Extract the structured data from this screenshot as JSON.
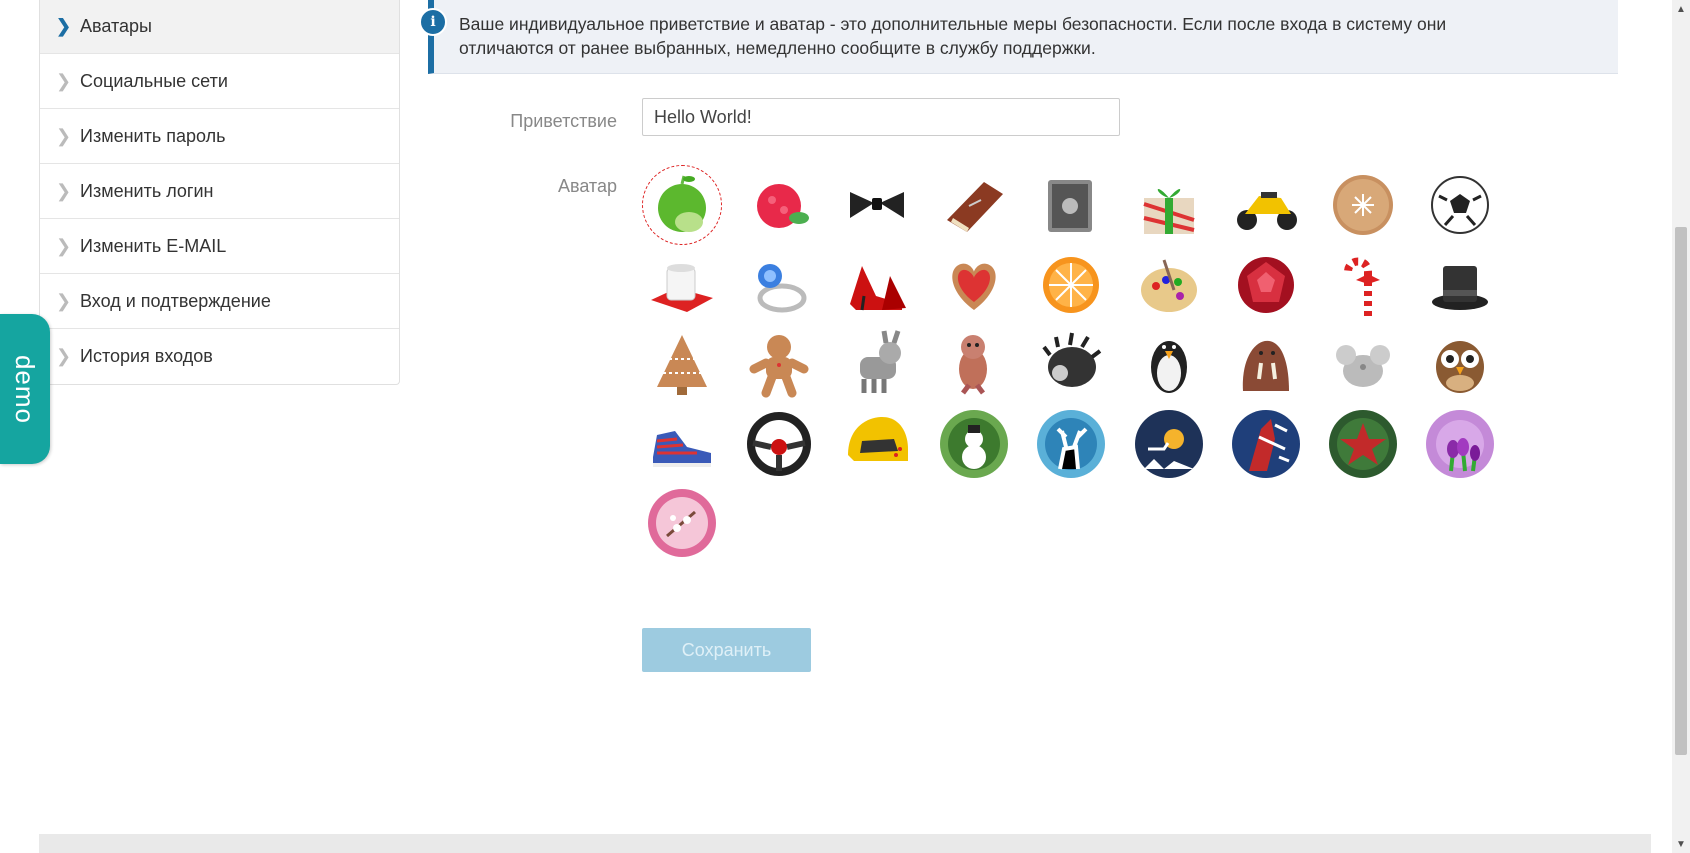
{
  "sidebar": {
    "items": [
      {
        "label": "Аватары",
        "active": true
      },
      {
        "label": "Социальные сети"
      },
      {
        "label": "Изменить пароль"
      },
      {
        "label": "Изменить логин"
      },
      {
        "label": "Изменить E-MAIL"
      },
      {
        "label": "Вход и подтверждение"
      },
      {
        "label": "История входов"
      }
    ]
  },
  "demo_tab": {
    "label": "demo"
  },
  "info": {
    "icon": "info-icon",
    "text": "Ваше индивидуальное приветствие и аватар - это дополнительные меры безопасности. Если после входа в систему они отличаются от ранее выбранных, немедленно сообщите в службу поддержки."
  },
  "form": {
    "greeting_label": "Приветствие",
    "greeting_value": "Hello World!",
    "avatar_label": "Аватар",
    "save_label": "Сохранить"
  },
  "avatars": [
    {
      "name": "apple",
      "selected": true
    },
    {
      "name": "raspberry"
    },
    {
      "name": "bow-tie"
    },
    {
      "name": "book"
    },
    {
      "name": "safe"
    },
    {
      "name": "gift"
    },
    {
      "name": "motorcycle"
    },
    {
      "name": "cookie"
    },
    {
      "name": "soccer-ball"
    },
    {
      "name": "cup"
    },
    {
      "name": "ring"
    },
    {
      "name": "high-heels"
    },
    {
      "name": "heart-cookie"
    },
    {
      "name": "orange"
    },
    {
      "name": "palette"
    },
    {
      "name": "ruby"
    },
    {
      "name": "candy-cane"
    },
    {
      "name": "top-hat"
    },
    {
      "name": "gingerbread-tree"
    },
    {
      "name": "gingerbread-man"
    },
    {
      "name": "donkey"
    },
    {
      "name": "squirrel"
    },
    {
      "name": "hedgehog"
    },
    {
      "name": "penguin"
    },
    {
      "name": "walrus"
    },
    {
      "name": "mouse"
    },
    {
      "name": "owl"
    },
    {
      "name": "sneaker"
    },
    {
      "name": "steering-wheel"
    },
    {
      "name": "helmet"
    },
    {
      "name": "snowman-badge"
    },
    {
      "name": "deer-badge"
    },
    {
      "name": "sleigh-badge"
    },
    {
      "name": "planes-badge"
    },
    {
      "name": "star-badge"
    },
    {
      "name": "tulips-badge"
    },
    {
      "name": "sakura-badge"
    }
  ],
  "colors": {
    "accent": "#1c6ea4",
    "demo": "#15a5a0",
    "save_button": "#9dcbe0"
  }
}
